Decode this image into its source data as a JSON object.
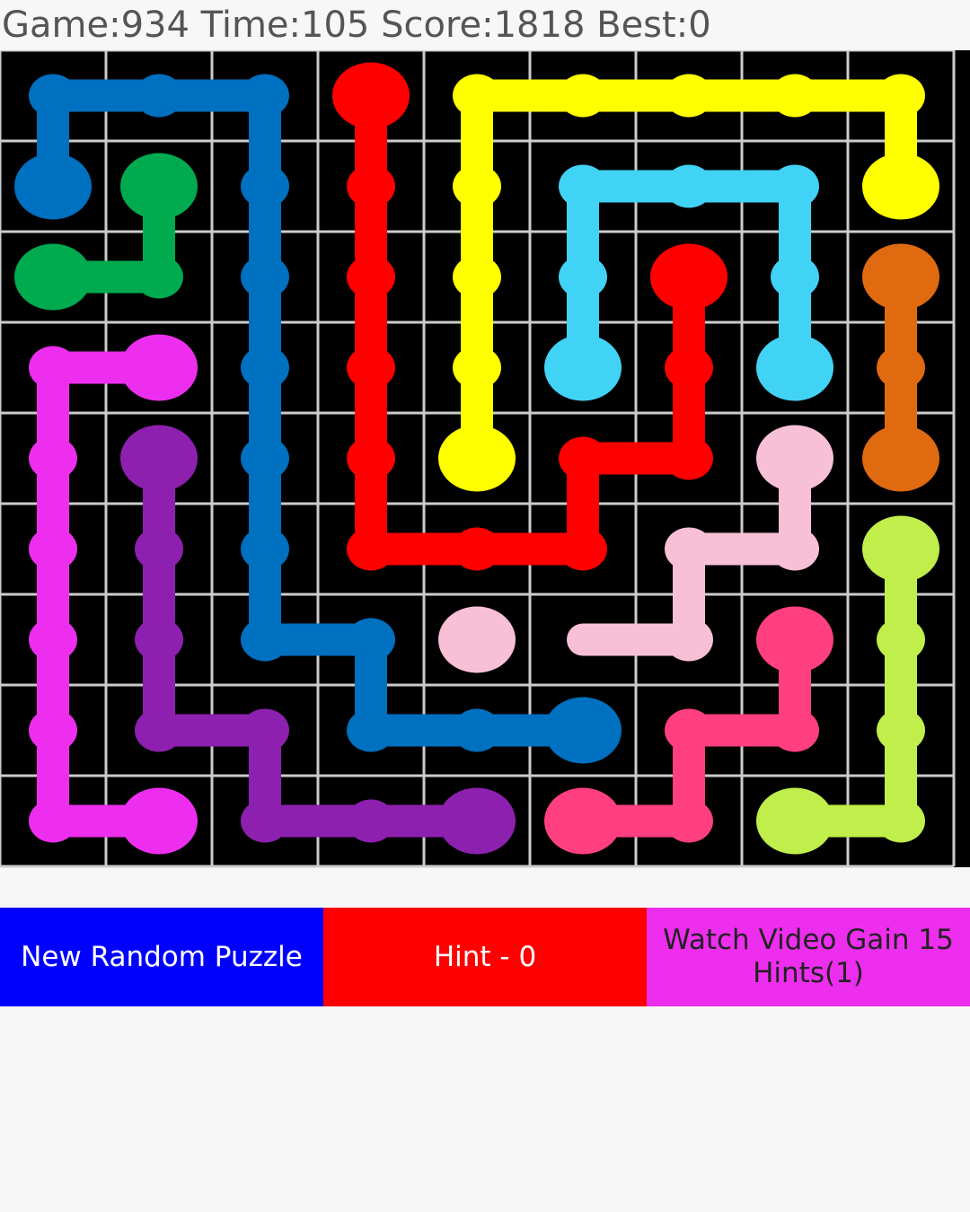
{
  "status": {
    "game_label": "Game:",
    "game": "934",
    "time_label": "Time:",
    "time": "105",
    "score_label": "Score:",
    "score": "1818",
    "best_label": "Best:",
    "best": "0"
  },
  "board": {
    "cols": 9,
    "rows": 9,
    "background": "#000000",
    "grid_color": "#cccccc",
    "flows": [
      {
        "name": "dark-blue",
        "color": "#0070c0",
        "endpoints": [
          [
            0,
            1
          ],
          [
            5,
            7
          ]
        ],
        "path": [
          [
            0,
            1
          ],
          [
            0,
            0
          ],
          [
            1,
            0
          ],
          [
            2,
            0
          ],
          [
            2,
            1
          ],
          [
            2,
            2
          ],
          [
            2,
            3
          ],
          [
            2,
            4
          ],
          [
            2,
            5
          ],
          [
            2,
            6
          ],
          [
            3,
            6
          ],
          [
            3,
            7
          ],
          [
            4,
            7
          ],
          [
            5,
            7
          ]
        ]
      },
      {
        "name": "green",
        "color": "#00aa4f",
        "endpoints": [
          [
            1,
            1
          ],
          [
            0,
            2
          ]
        ],
        "path": [
          [
            1,
            1
          ],
          [
            1,
            2
          ],
          [
            0,
            2
          ]
        ]
      },
      {
        "name": "red",
        "color": "#ff0000",
        "endpoints": [
          [
            3,
            0
          ],
          [
            6,
            2
          ]
        ],
        "path": [
          [
            3,
            0
          ],
          [
            3,
            1
          ],
          [
            3,
            2
          ],
          [
            3,
            3
          ],
          [
            3,
            4
          ],
          [
            3,
            5
          ],
          [
            4,
            5
          ],
          [
            5,
            5
          ],
          [
            5,
            4
          ],
          [
            6,
            4
          ],
          [
            6,
            3
          ],
          [
            6,
            2
          ]
        ]
      },
      {
        "name": "yellow",
        "color": "#ffff00",
        "endpoints": [
          [
            4,
            4
          ],
          [
            8,
            1
          ]
        ],
        "path": [
          [
            4,
            4
          ],
          [
            4,
            3
          ],
          [
            4,
            2
          ],
          [
            4,
            1
          ],
          [
            4,
            0
          ],
          [
            5,
            0
          ],
          [
            6,
            0
          ],
          [
            7,
            0
          ],
          [
            8,
            0
          ],
          [
            8,
            1
          ]
        ]
      },
      {
        "name": "cyan",
        "color": "#41d3f5",
        "endpoints": [
          [
            5,
            3
          ],
          [
            7,
            3
          ]
        ],
        "path": [
          [
            5,
            3
          ],
          [
            5,
            2
          ],
          [
            5,
            1
          ],
          [
            6,
            1
          ],
          [
            7,
            1
          ],
          [
            7,
            2
          ],
          [
            7,
            3
          ]
        ]
      },
      {
        "name": "orange",
        "color": "#e06a0f",
        "endpoints": [
          [
            8,
            2
          ],
          [
            8,
            4
          ]
        ],
        "path": [
          [
            8,
            2
          ],
          [
            8,
            3
          ],
          [
            8,
            4
          ]
        ]
      },
      {
        "name": "magenta",
        "color": "#ee2eee",
        "endpoints": [
          [
            1,
            3
          ],
          [
            1,
            8
          ]
        ],
        "path": [
          [
            1,
            3
          ],
          [
            0,
            3
          ],
          [
            0,
            4
          ],
          [
            0,
            5
          ],
          [
            0,
            6
          ],
          [
            0,
            7
          ],
          [
            0,
            8
          ],
          [
            1,
            8
          ]
        ]
      },
      {
        "name": "purple",
        "color": "#8e20b0",
        "endpoints": [
          [
            1,
            4
          ],
          [
            4,
            8
          ]
        ],
        "path": [
          [
            1,
            4
          ],
          [
            1,
            5
          ],
          [
            1,
            6
          ],
          [
            1,
            7
          ],
          [
            2,
            7
          ],
          [
            2,
            8
          ],
          [
            3,
            8
          ],
          [
            4,
            8
          ]
        ]
      },
      {
        "name": "light-pink",
        "color": "#f8c0d6",
        "endpoints": [
          [
            7,
            4
          ],
          [
            4,
            6
          ]
        ],
        "path": [
          [
            7,
            4
          ],
          [
            7,
            5
          ],
          [
            6,
            5
          ],
          [
            6,
            6
          ],
          [
            5,
            6
          ]
        ]
      },
      {
        "name": "lime",
        "color": "#c0ee4a",
        "endpoints": [
          [
            8,
            5
          ],
          [
            7,
            8
          ]
        ],
        "path": [
          [
            8,
            5
          ],
          [
            8,
            6
          ],
          [
            8,
            7
          ],
          [
            8,
            8
          ],
          [
            7,
            8
          ]
        ]
      },
      {
        "name": "pink",
        "color": "#ff3f80",
        "endpoints": [
          [
            7,
            6
          ],
          [
            5,
            8
          ]
        ],
        "path": [
          [
            7,
            6
          ],
          [
            7,
            7
          ],
          [
            6,
            7
          ],
          [
            6,
            8
          ],
          [
            5,
            8
          ]
        ]
      }
    ]
  },
  "buttons": {
    "new_puzzle": "New Random Puzzle",
    "hint": "Hint - 0",
    "video_line1": "Watch Video Gain 15",
    "video_line2": "Hints(1)"
  },
  "colors": {
    "new_puzzle_bg": "#0000ff",
    "hint_bg": "#ff0000",
    "video_bg": "#ee2eee"
  }
}
